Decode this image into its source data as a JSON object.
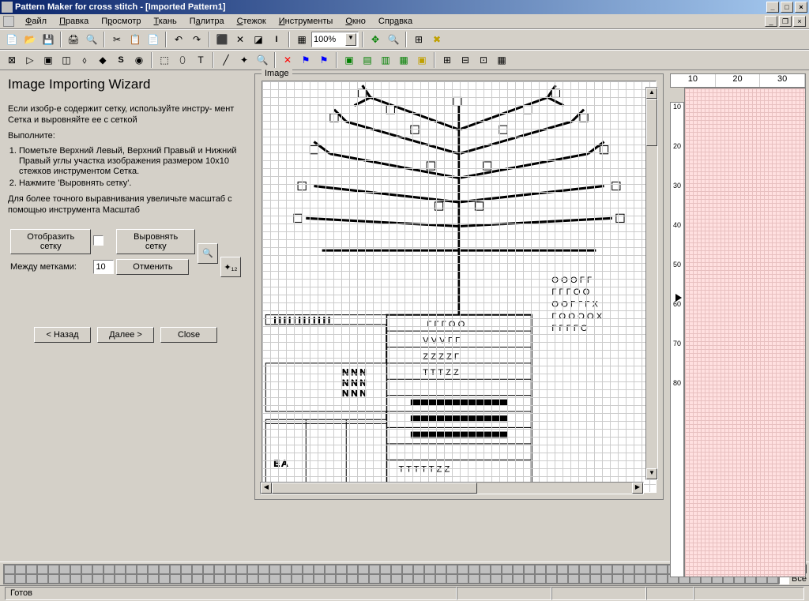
{
  "window": {
    "title": "Pattern Maker for cross stitch - [Imported Pattern1]"
  },
  "menu": {
    "items": [
      "Файл",
      "Правка",
      "Просмотр",
      "Ткань",
      "Палитра",
      "Стежок",
      "Инструменты",
      "Окно",
      "Справка"
    ]
  },
  "toolbar1": {
    "zoom": "100%"
  },
  "wizard": {
    "title": "Image Importing Wizard",
    "p1": "Если изобр-е содержит сетку, используйте инстру- мент Сетка и выровняйте ее с сеткой",
    "p2": "Выполните:",
    "li1": "Пометьте Верхний Левый, Верхний Правый и Нижний Правый углы участка изображения размером 10x10 стежков инструментом Сетка.",
    "li2": "Нажмите 'Выровнять сетку'.",
    "p3": "Для более точного выравнивания увеличьте масштаб с помощью инструмента Масштаб",
    "show_grid": "Отобразить сетку",
    "align_grid": "Выровнять сетку",
    "between_marks": "Между метками:",
    "between_value": "10",
    "cancel": "Отменить",
    "back": "< Назад",
    "next": "Далее >",
    "close": "Close"
  },
  "image_panel": {
    "label": "Image"
  },
  "ruler": {
    "ticks_h": [
      "10",
      "20",
      "30"
    ],
    "ticks_v": [
      "10",
      "20",
      "30",
      "40",
      "50",
      "60",
      "70",
      "80"
    ]
  },
  "palette": {
    "all_label": "Все"
  },
  "status": {
    "text": "Готов"
  }
}
